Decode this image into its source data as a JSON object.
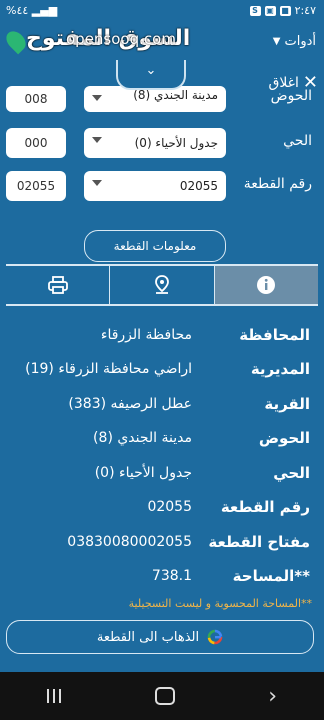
{
  "status": {
    "time": "٢:٤٧",
    "battery": "%٤٤"
  },
  "header": {
    "tools_label": "أدوات",
    "watermark_ar": "السوق المفتوح",
    "watermark_en": "opensooq.com",
    "collapse_symbol": "⌄",
    "close_label": "اغلاق",
    "close_symbol": "✕"
  },
  "form": {
    "row1": {
      "label": "الحوض",
      "select": "مدينة الجندي (8)",
      "input": "008"
    },
    "row2": {
      "label": "الحي",
      "select": "جدول الأحياء (0)",
      "input": "000"
    },
    "row3": {
      "label": "رقم القطعة",
      "select": "02055",
      "input": "02055"
    }
  },
  "info_button_label": "معلومات القطعة",
  "tabs": [
    "info",
    "location",
    "print"
  ],
  "details": [
    {
      "key": "المحافظة",
      "value": "محافظة الزرقاء"
    },
    {
      "key": "المديرية",
      "value": "اراضي محافظة الزرقاء (19)"
    },
    {
      "key": "القرية",
      "value": "عطل الرصيفه (383)"
    },
    {
      "key": "الحوض",
      "value": "مدينة الجندي (8)"
    },
    {
      "key": "الحي",
      "value": "جدول الأحياء (0)"
    },
    {
      "key": "رقم القطعة",
      "value": "02055"
    },
    {
      "key": "مفتاح القطعة",
      "value": "03830080002055"
    },
    {
      "key": "المساحة**",
      "value": "738.1"
    }
  ],
  "note": "**المساحة المحسوبة و ليست التسجيلية",
  "goto_label": "الذهاب الى القطعة",
  "colors": {
    "background": "#1d6b9f",
    "active_tab": "#6b8ea8",
    "note": "#f0b54a"
  }
}
